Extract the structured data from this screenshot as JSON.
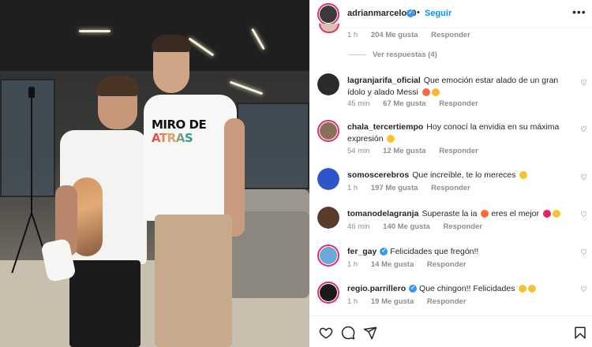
{
  "post": {
    "author": "adrianmarcelo10",
    "verified": true,
    "separator": "•",
    "follow_label": "Seguir",
    "more_label": "•••",
    "shirt_text_line1": "MIRO DE",
    "shirt_text_line2": "ATRAS"
  },
  "previous_comment": {
    "time": "1 h",
    "likes": "204 Me gusta",
    "reply_label": "Responder",
    "view_replies": "Ver respuestas (4)"
  },
  "comments": [
    {
      "user": "lagranjarifa_oficial",
      "verified": false,
      "text": "Que emoción estar alado de un gran ídolo y alado Messi",
      "emoji": [
        "#ff6a3d",
        "#f7b733"
      ],
      "time": "45 min",
      "likes": "67 Me gusta",
      "reply_label": "Responder",
      "avatar_color": "#2b2b2b"
    },
    {
      "user": "chala_tercertiempo",
      "verified": false,
      "text": "Hoy conocí la envidia en su máxima expresión",
      "emoji": [
        "#f4c430"
      ],
      "time": "54 min",
      "likes": "12 Me gusta",
      "reply_label": "Responder",
      "avatar_color": "#8d6e5a"
    },
    {
      "user": "somoscerebros",
      "verified": false,
      "text": "Que increíble, te lo mereces",
      "emoji": [
        "#f4c430"
      ],
      "time": "1 h",
      "likes": "197 Me gusta",
      "reply_label": "Responder",
      "avatar_color": "#2f55c9"
    },
    {
      "user": "tomanodelagranja",
      "verified": false,
      "text": "Superaste la ia",
      "text2": "eres el mejor",
      "emoji": [
        "#ff6a3d"
      ],
      "emoji2": [
        "#e0245e",
        "#f4c430"
      ],
      "time": "46 min",
      "likes": "140 Me gusta",
      "reply_label": "Responder",
      "avatar_color": "#5a3a2a"
    },
    {
      "user": "fer_gay",
      "verified": true,
      "text": "Felicidades que fregón!!",
      "emoji": [],
      "time": "1 h",
      "likes": "14 Me gusta",
      "reply_label": "Responder",
      "avatar_color": "#6aa9d8"
    },
    {
      "user": "regio.parrillero",
      "verified": true,
      "text": "Que chingon!! Felicidades",
      "emoji": [
        "#f4c430",
        "#f4c430"
      ],
      "time": "1 h",
      "likes": "19 Me gusta",
      "reply_label": "Responder",
      "avatar_color": "#1a1a1a"
    }
  ],
  "footer": {
    "icons": [
      "heart-icon",
      "comment-icon",
      "share-icon",
      "bookmark-icon"
    ]
  },
  "colors": {
    "accent": "#0095f6",
    "verified": "#3897f0",
    "story_ring": "#e1306c"
  }
}
